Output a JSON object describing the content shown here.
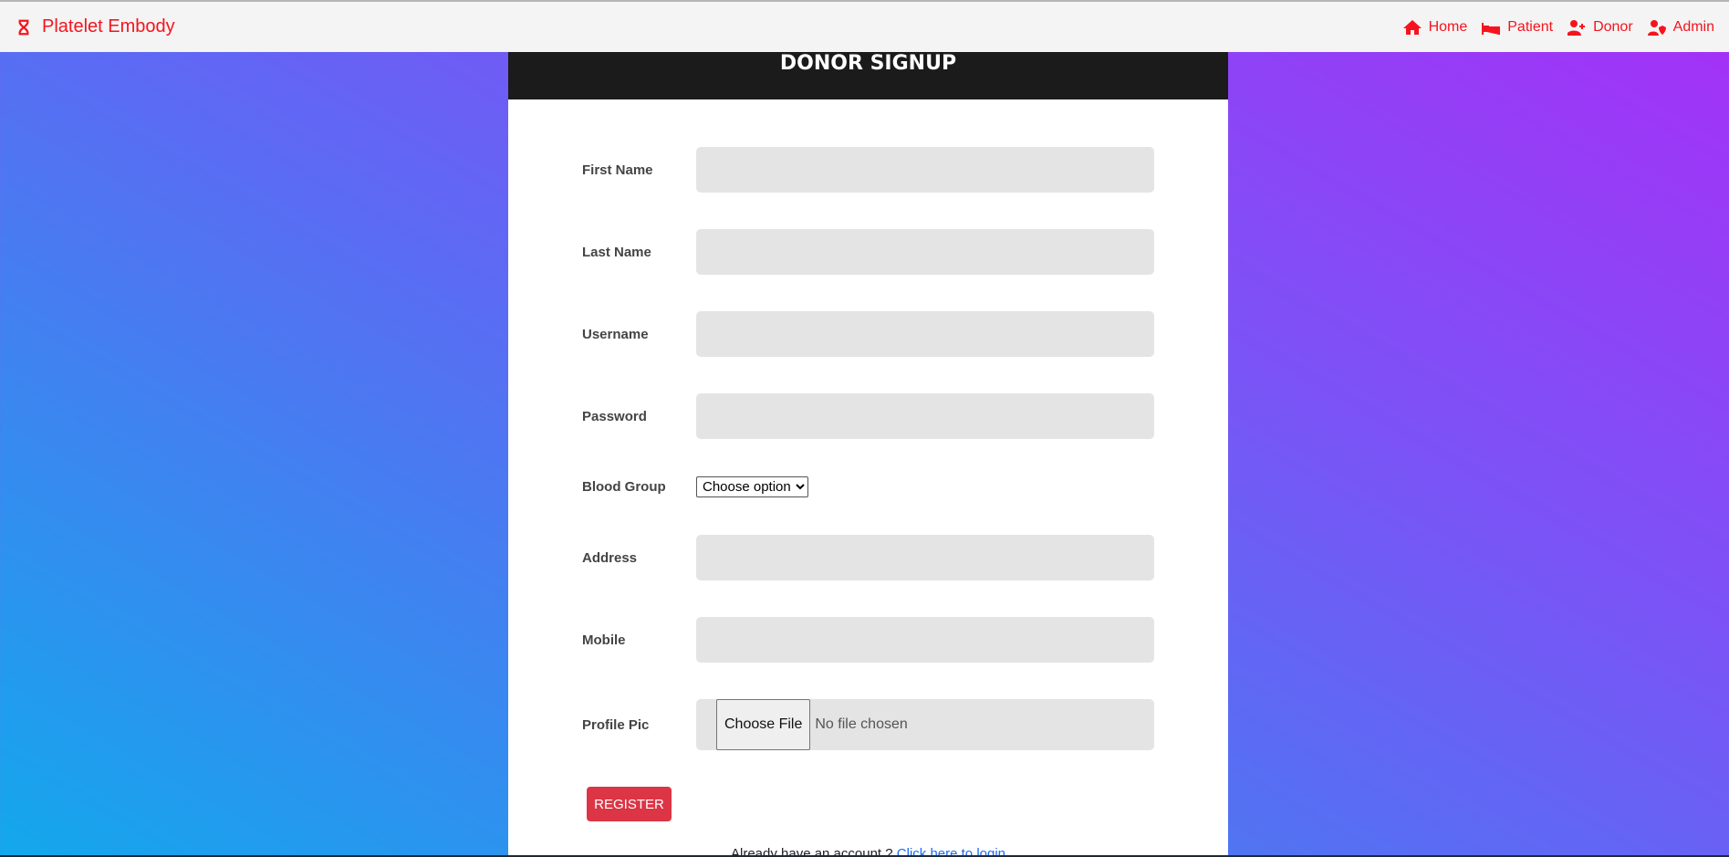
{
  "nav": {
    "brand": "Platelet Embody",
    "links": [
      {
        "label": "Home",
        "icon": "home-icon"
      },
      {
        "label": "Patient",
        "icon": "bed-icon"
      },
      {
        "label": "Donor",
        "icon": "user-plus-icon"
      },
      {
        "label": "Admin",
        "icon": "user-shield-icon"
      }
    ]
  },
  "form": {
    "title": "DONOR SIGNUP",
    "first_name": "First Name",
    "last_name": "Last Name",
    "username": "Username",
    "password": "Password",
    "blood_group": "Blood Group",
    "blood_group_value": "Choose option",
    "address": "Address",
    "mobile": "Mobile",
    "profile_pic": "Profile Pic",
    "choose_file": "Choose File",
    "no_file": "No file chosen",
    "register": "REGISTER",
    "have_account": "Already have an account ? ",
    "login_link": "Click here to login"
  },
  "colors": {
    "accent": "#f5141e",
    "button": "#dc3545"
  }
}
